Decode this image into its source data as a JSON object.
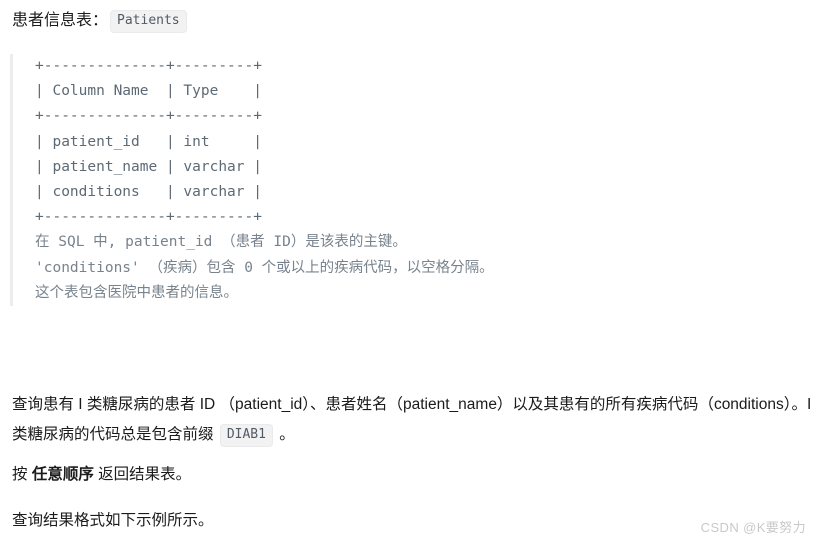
{
  "document": {
    "title_prefix": "患者信息表：",
    "table_name_chip": "Patients"
  },
  "schema_block": {
    "ascii_table": "+--------------+---------+\n| Column Name  | Type    |\n+--------------+---------+\n| patient_id   | int     |\n| patient_name | varchar |\n| conditions   | varchar |\n+--------------+---------+",
    "notes": [
      "在 SQL 中, patient_id （患者 ID）是该表的主键。",
      "'conditions' （疾病）包含 0 个或以上的疾病代码，以空格分隔。",
      "这个表包含医院中患者的信息。"
    ]
  },
  "question": {
    "part1": "查询患有 I 类糖尿病的患者 ID （patient_id）、患者姓名（patient_name）以及其患有的所有疾病代码（conditions）。I 类糖尿病的代码总是包含前缀 ",
    "code_chip": "DIAB1",
    "part2": " 。"
  },
  "order_note": {
    "prefix": "按 ",
    "emphasis": "任意顺序",
    "suffix": " 返回结果表。"
  },
  "format_note": {
    "text": "查询结果格式如下示例所示。"
  },
  "watermark": {
    "text": "CSDN @K要努力"
  },
  "colors": {
    "page_background": "#ffffff",
    "body_text": "#1b1b1b",
    "code_text": "#5d6a75",
    "note_text": "#78838d",
    "chip_background": "#f2f2f2",
    "chip_border": "#eaeaea",
    "quote_border": "#ededed",
    "watermark_text": "#c9c9c9"
  }
}
